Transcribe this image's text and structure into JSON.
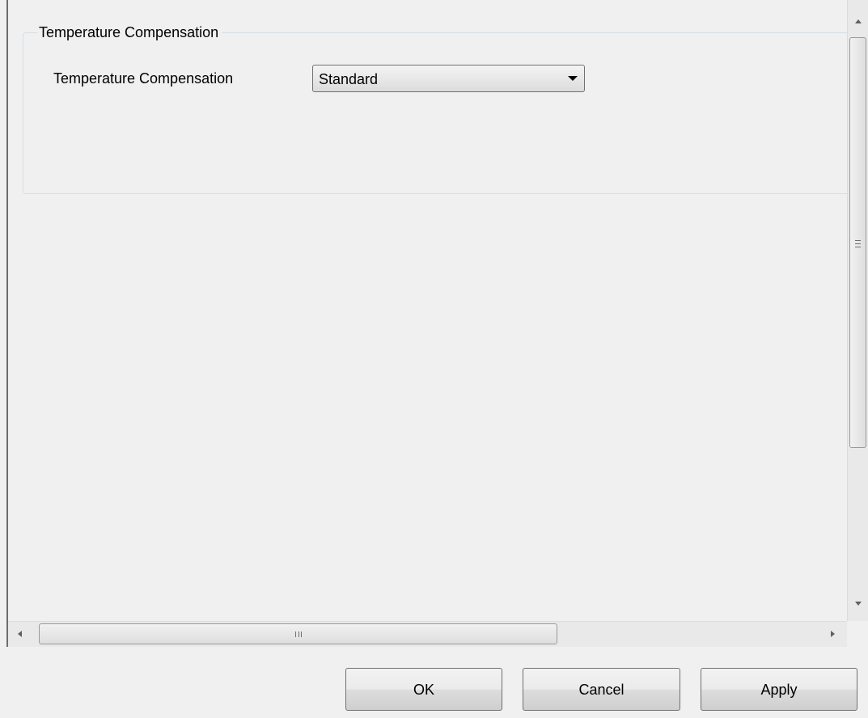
{
  "group": {
    "title": "Temperature Compensation",
    "field_label": "Temperature Compensation",
    "combo_value": "Standard"
  },
  "scrollbars": {
    "vertical_grip": "≡",
    "horizontal_grip": "III"
  },
  "buttons": {
    "ok": "OK",
    "cancel": "Cancel",
    "apply": "Apply"
  }
}
